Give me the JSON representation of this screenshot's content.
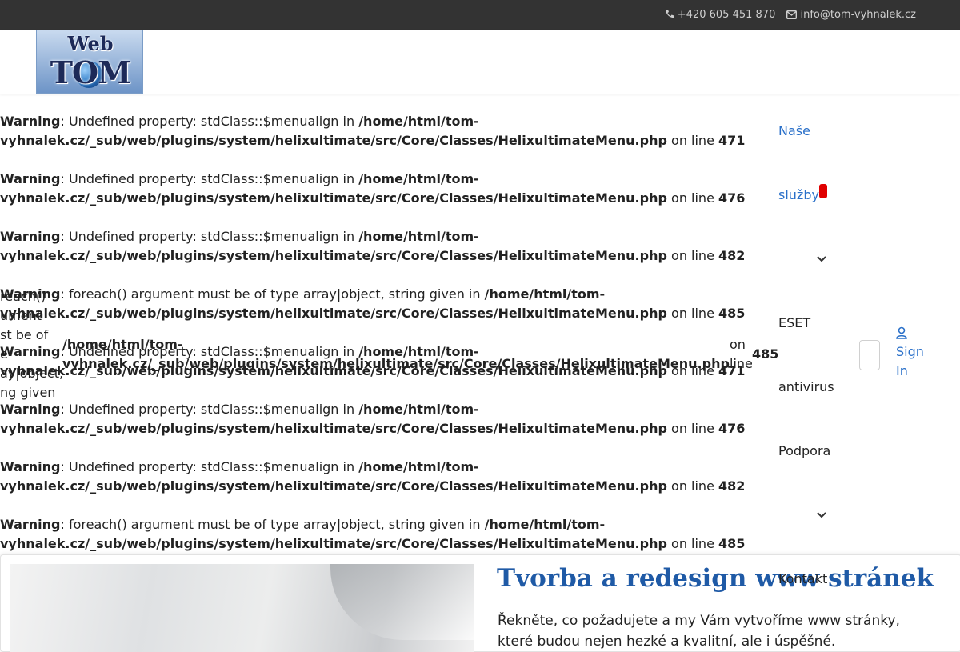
{
  "topbar": {
    "phone": "+420 605 451 870",
    "email": "info@tom-vyhnalek.cz"
  },
  "logo": {
    "line1": "Web",
    "line2": "TOM"
  },
  "warnings": [
    {
      "label": "Warning",
      "msg": ": Undefined property: stdClass::$menualign in ",
      "path": "/home/html/tom-vyhnalek.cz/_sub/web/plugins/system/helixultimate/src/Core/Classes/HelixultimateMenu.php",
      "online": " on line ",
      "line": "471"
    },
    {
      "label": "Warning",
      "msg": ": Undefined property: stdClass::$menualign in ",
      "path": "/home/html/tom-vyhnalek.cz/_sub/web/plugins/system/helixultimate/src/Core/Classes/HelixultimateMenu.php",
      "online": " on line ",
      "line": "476"
    },
    {
      "label": "Warning",
      "msg": ": Undefined property: stdClass::$menualign in ",
      "path": "/home/html/tom-vyhnalek.cz/_sub/web/plugins/system/helixultimate/src/Core/Classes/HelixultimateMenu.php",
      "online": " on line ",
      "line": "482"
    },
    {
      "label": "Warning",
      "msg": ": foreach() argument must be of type array|object, string given in ",
      "path": "/home/html/tom-vyhnalek.cz/_sub/web/plugins/system/helixultimate/src/Core/Classes/HelixultimateMenu.php",
      "online": " on line ",
      "line": "485"
    },
    {
      "label": "Warning",
      "msg": ": Undefined property: stdClass::$menualign in ",
      "path": "/home/html/tom-vyhnalek.cz/_sub/web/plugins/system/helixultimate/src/Core/Classes/HelixultimateMenu.php",
      "online": " on line ",
      "line": "471"
    },
    {
      "label": "Warning",
      "msg": ": Undefined property: stdClass::$menualign in ",
      "path": "/home/html/tom-vyhnalek.cz/_sub/web/plugins/system/helixultimate/src/Core/Classes/HelixultimateMenu.php",
      "online": " on line ",
      "line": "476"
    },
    {
      "label": "Warning",
      "msg": ": Undefined property: stdClass::$menualign in ",
      "path": "/home/html/tom-vyhnalek.cz/_sub/web/plugins/system/helixultimate/src/Core/Classes/HelixultimateMenu.php",
      "online": " on line ",
      "line": "482"
    },
    {
      "label": "Warning",
      "msg": ": foreach() argument must be of type array|object, string given in ",
      "path": "/home/html/tom-vyhnalek.cz/_sub/web/plugins/system/helixultimate/src/Core/Classes/HelixultimateMenu.php",
      "online": " on line ",
      "line": "485"
    }
  ],
  "ghost": {
    "left_lines": [
      "reach()",
      "ument",
      "st be of",
      "e",
      "ay|object,",
      "ng given"
    ],
    "path_line1": "/home/html/tom-",
    "path_line2": "vyhnalek.cz/_sub/web/plugins/system/helixultimate/src/Core/Classes/HelixultimateMenu.php",
    "on": "on",
    "line_word": "line",
    "line_num": "485"
  },
  "nav": {
    "item1_a": "Naše",
    "item1_b": "služby",
    "item2_a": "ESET",
    "item2_b": "antivirus",
    "item3": "Podpora",
    "item4": "Kontakt",
    "signin_a": "Sign",
    "signin_b": "In"
  },
  "hero": {
    "title": "Tvorba a redesign www stránek",
    "text": "Řekněte, co požadujete a my Vám vytvoříme www stránky, které budou nejen hezké a kvalitní, ale i úspěšné."
  },
  "colors": {
    "link": "#2a70c9",
    "title": "#1f5aa6",
    "topbar": "#333333",
    "badge": "#e00000"
  }
}
